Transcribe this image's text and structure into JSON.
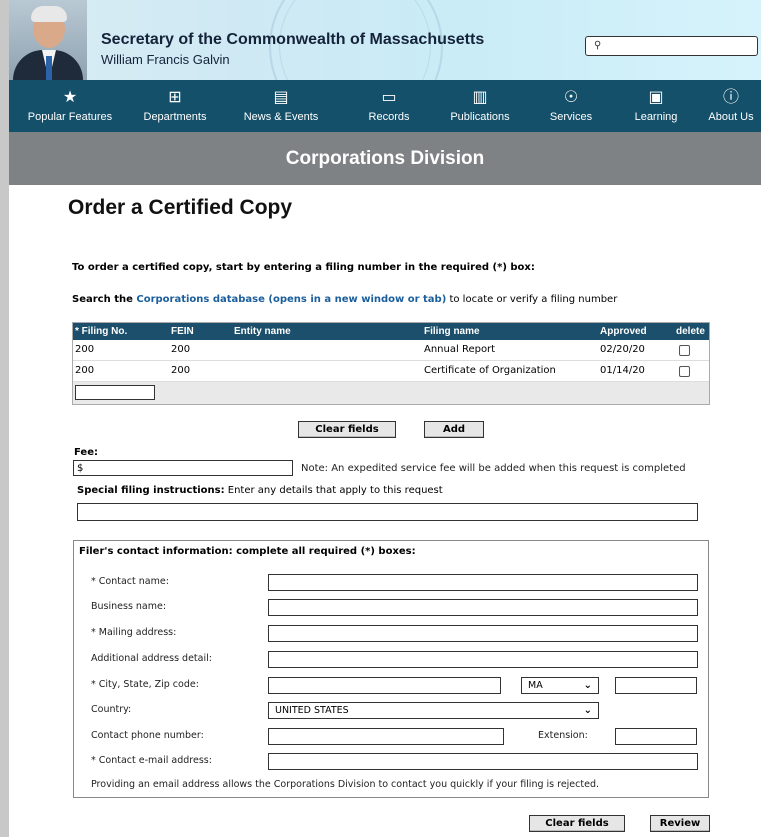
{
  "header": {
    "title": "Secretary of the Commonwealth of Massachusetts",
    "subtitle": "William Francis Galvin",
    "search_placeholder": ""
  },
  "nav": {
    "items": [
      {
        "label": "Popular Features",
        "icon": "star-icon",
        "glyph": "★"
      },
      {
        "label": "Departments",
        "icon": "org-chart-icon",
        "glyph": "⊞"
      },
      {
        "label": "News & Events",
        "icon": "newspaper-icon",
        "glyph": "▤"
      },
      {
        "label": "Records",
        "icon": "archive-box-icon",
        "glyph": "▭"
      },
      {
        "label": "Publications",
        "icon": "open-book-icon",
        "glyph": "▥"
      },
      {
        "label": "Services",
        "icon": "hand-service-icon",
        "glyph": "☉"
      },
      {
        "label": "Learning",
        "icon": "certificate-icon",
        "glyph": "▣"
      },
      {
        "label": "About Us",
        "icon": "info-icon",
        "glyph": "ⓘ"
      }
    ]
  },
  "division": "Corporations Division",
  "page_title": "Order a Certified Copy",
  "intro": "To order a certified copy, start by entering a filing number in the required (*) box:",
  "search_line": {
    "prefix": "Search the ",
    "link": "Corporations database (opens in a new window or tab)",
    "suffix": " to locate or verify a filing number"
  },
  "filings_table": {
    "headers": [
      "* Filing No.",
      "FEIN",
      "Entity name",
      "Filing name",
      "Approved",
      "delete"
    ],
    "rows": [
      {
        "filing_no": "200",
        "fein": "200",
        "entity": "",
        "filing_name": "Annual Report",
        "approved": "02/20/20"
      },
      {
        "filing_no": "200",
        "fein": "200",
        "entity": "",
        "filing_name": "Certificate of Organization",
        "approved": "01/14/20"
      }
    ]
  },
  "buttons": {
    "clear_fields": "Clear fields",
    "add": "Add",
    "clear_fields_bottom": "Clear fields",
    "review": "Review"
  },
  "fee": {
    "label": "Fee:",
    "value": "$",
    "note": "Note: An expedited service fee will be added when this request is completed"
  },
  "special": {
    "label_bold": "Special filing instructions:",
    "label_rest": " Enter any details that apply to this request"
  },
  "contact": {
    "title": "Filer's contact information: complete all required (*) boxes:",
    "labels": {
      "contact_name": "* Contact name:",
      "business_name": "Business name:",
      "mailing_address": "* Mailing address:",
      "additional_address": "Additional address detail:",
      "city_state_zip": "* City, State, Zip code:",
      "country": "Country:",
      "phone": "Contact phone number:",
      "extension": "Extension:",
      "email": "* Contact e-mail address:"
    },
    "state_value": "MA",
    "country_value": "UNITED STATES",
    "email_note": "Providing an email address allows the Corporations Division to contact you quickly if your filing is rejected."
  }
}
